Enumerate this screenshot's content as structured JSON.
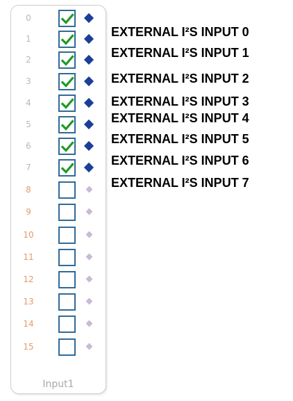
{
  "panel": {
    "title": "Input1"
  },
  "colors": {
    "active_number": "#b8b8b8",
    "inactive_number": "#e59a6c",
    "checkbox_border": "#2f6b98",
    "checkmark": "#1e9b27",
    "active_pin": "#1b3f98",
    "inactive_pin": "#c9bad8"
  },
  "channels": [
    {
      "number": "0",
      "checked": true,
      "active": true,
      "label": "EXTERNAL I²S INPUT 0"
    },
    {
      "number": "1",
      "checked": true,
      "active": true,
      "label": "EXTERNAL I²S INPUT 1"
    },
    {
      "number": "2",
      "checked": true,
      "active": true,
      "label": "EXTERNAL I²S INPUT 2"
    },
    {
      "number": "3",
      "checked": true,
      "active": true,
      "label": "EXTERNAL I²S INPUT 3"
    },
    {
      "number": "4",
      "checked": true,
      "active": true,
      "label": "EXTERNAL I²S INPUT 4"
    },
    {
      "number": "5",
      "checked": true,
      "active": true,
      "label": "EXTERNAL I²S INPUT 5"
    },
    {
      "number": "6",
      "checked": true,
      "active": true,
      "label": "EXTERNAL I²S INPUT 6"
    },
    {
      "number": "7",
      "checked": true,
      "active": true,
      "label": "EXTERNAL I²S INPUT 7"
    },
    {
      "number": "8",
      "checked": false,
      "active": false,
      "label": ""
    },
    {
      "number": "9",
      "checked": false,
      "active": false,
      "label": ""
    },
    {
      "number": "10",
      "checked": false,
      "active": false,
      "label": ""
    },
    {
      "number": "11",
      "checked": false,
      "active": false,
      "label": ""
    },
    {
      "number": "12",
      "checked": false,
      "active": false,
      "label": ""
    },
    {
      "number": "13",
      "checked": false,
      "active": false,
      "label": ""
    },
    {
      "number": "14",
      "checked": false,
      "active": false,
      "label": ""
    },
    {
      "number": "15",
      "checked": false,
      "active": false,
      "label": ""
    }
  ]
}
